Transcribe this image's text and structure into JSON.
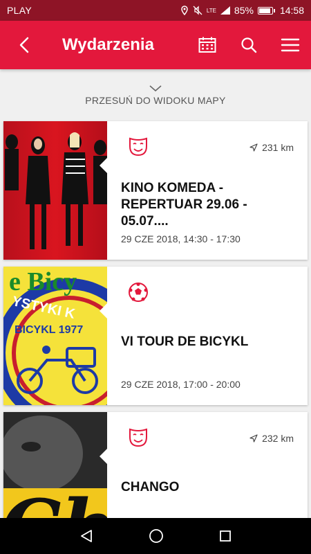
{
  "status": {
    "carrier": "PLAY",
    "battery": "85%",
    "time": "14:58",
    "network": "LTE"
  },
  "appbar": {
    "title": "Wydarzenia"
  },
  "map_hint": "PRZESUŃ DO WIDOKU MAPY",
  "events": [
    {
      "icon": "theater-mask-icon",
      "distance": "231 km",
      "name": "KINO KOMEDA - REPERTUAR 29.06 - 05.07....",
      "date": "29 CZE 2018, 14:30 - 17:30"
    },
    {
      "icon": "soccer-ball-icon",
      "distance": "",
      "name": "VI TOUR DE BICYKL",
      "date": "29 CZE 2018, 17:00 - 20:00"
    },
    {
      "icon": "theater-mask-icon",
      "distance": "232 km",
      "name": "CHANGO",
      "date": ""
    }
  ],
  "thumb2_text": {
    "top": "e Bicy",
    "ring": "YSTYKI K",
    "club": "BICYKL 1977"
  },
  "thumb3_text": "Ch",
  "colors": {
    "accent": "#e3183c",
    "statusbar": "#8e1426"
  }
}
